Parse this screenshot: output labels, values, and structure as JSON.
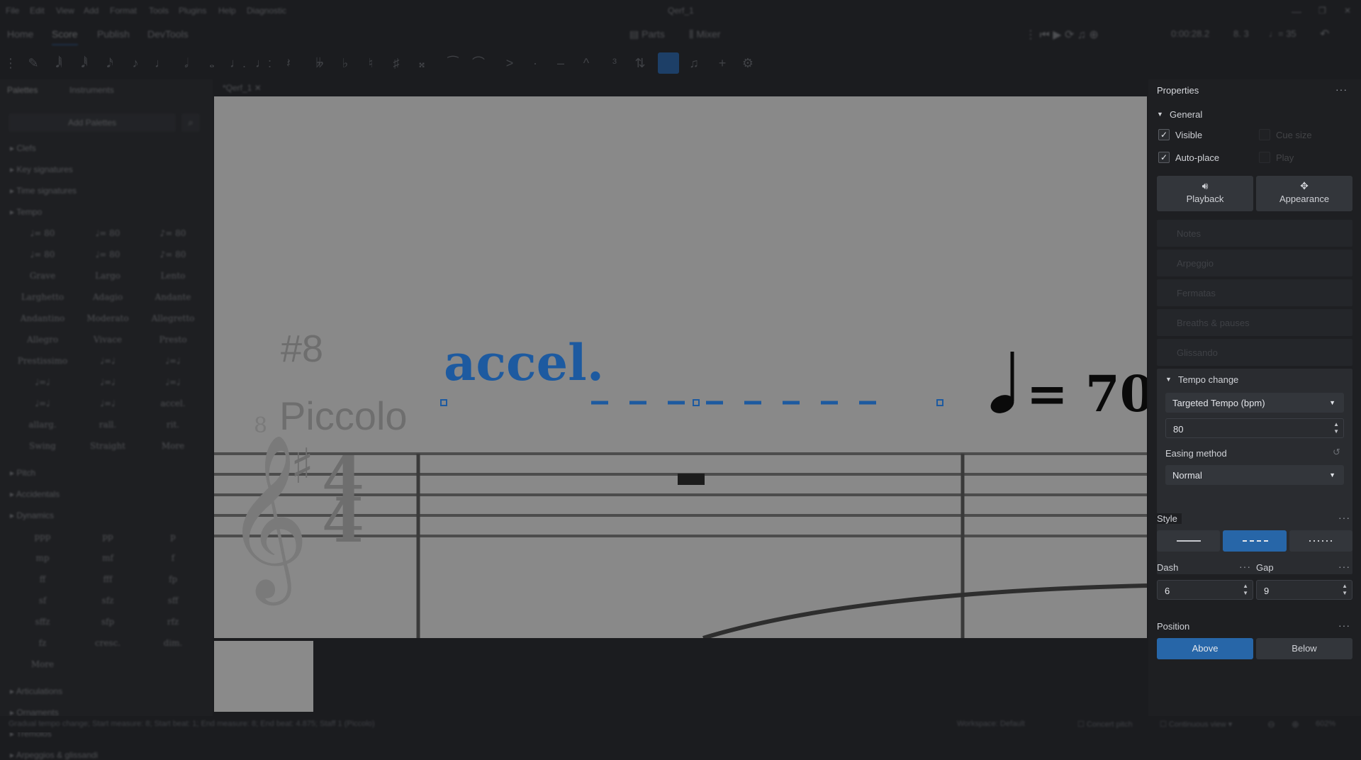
{
  "window": {
    "title": "Qerf_1"
  },
  "menu": [
    "File",
    "Edit",
    "View",
    "Add",
    "Format",
    "Tools",
    "Plugins",
    "Help",
    "Diagnostic"
  ],
  "main_tabs": [
    "Home",
    "Score",
    "Publish",
    "DevTools"
  ],
  "top_center": {
    "parts": "Parts",
    "mixer": "Mixer"
  },
  "playback": {
    "time": "0:00:28.2",
    "position": "8. 3",
    "tempo": "♩= 35"
  },
  "left_panel": {
    "tabs": [
      "Palettes",
      "Instruments"
    ],
    "add_palettes": "Add Palettes",
    "sections": [
      "Clefs",
      "Key signatures",
      "Time signatures",
      "Tempo",
      "Pitch",
      "Accidentals",
      "Dynamics",
      "Articulations",
      "Ornaments",
      "Tremolos",
      "Arpeggios & glissandi"
    ],
    "tempo_cells": [
      "♩= 80",
      "♩= 80",
      "♪= 80",
      "♩= 80",
      "♩= 80",
      "♪= 80",
      "Grave",
      "Largo",
      "Lento",
      "Larghetto",
      "Adagio",
      "Andante",
      "Andantino",
      "Moderato",
      "Allegretto",
      "Allegro",
      "Vivace",
      "Presto",
      "Prestissimo",
      "♩=♩",
      "♩=♩",
      "♩=♩",
      "♩=♩",
      "♩=♩",
      "♩=♩",
      "♩=♩",
      "accel.",
      "allarg.",
      "rall.",
      "rit.",
      "Swing",
      "Straight",
      "More"
    ],
    "dynamics_cells": [
      "ppp",
      "pp",
      "p",
      "mp",
      "mf",
      "f",
      "ff",
      "fff",
      "fp",
      "sf",
      "sfz",
      "sff",
      "sffz",
      "sfp",
      "rfz",
      "fz",
      "cresc.",
      "dim.",
      "More"
    ]
  },
  "score_tab": "*Qerf_1",
  "score": {
    "measure_number": "#8",
    "instrument": "Piccolo",
    "accel_text": "accel.",
    "tempo_mark": "= 70",
    "clef_number": "8",
    "time_sig_top": "4",
    "time_sig_bottom": "4"
  },
  "status": {
    "message": "Gradual tempo change; Start measure: 8; Start beat: 1; End measure: 8; End beat: 4.875; Staff 1 (Piccolo)",
    "workspace": "Workspace: Default",
    "concert_pitch": "Concert pitch",
    "view_mode": "Continuous view",
    "zoom": "602%"
  },
  "properties": {
    "title": "Properties",
    "general": "General",
    "visible": "Visible",
    "cue_size": "Cue size",
    "auto_place": "Auto-place",
    "play": "Play",
    "playback_btn": "Playback",
    "appearance_btn": "Appearance",
    "dim_sections": [
      "Notes",
      "Arpeggio",
      "Fermatas",
      "Breaths & pauses",
      "Glissando"
    ],
    "tempo_change": {
      "header": "Tempo change",
      "mode": "Targeted Tempo (bpm)",
      "value": "80",
      "easing_label": "Easing method",
      "easing": "Normal"
    },
    "style": {
      "label": "Style",
      "active_index": 1
    },
    "dash": {
      "label": "Dash",
      "value": "6"
    },
    "gap": {
      "label": "Gap",
      "value": "9"
    },
    "position": {
      "label": "Position",
      "above": "Above",
      "below": "Below"
    }
  },
  "colors": {
    "accent": "#2766a8",
    "panel": "#1e1f22",
    "score_bg": "#898989",
    "accel_blue": "#1d5aa0"
  }
}
